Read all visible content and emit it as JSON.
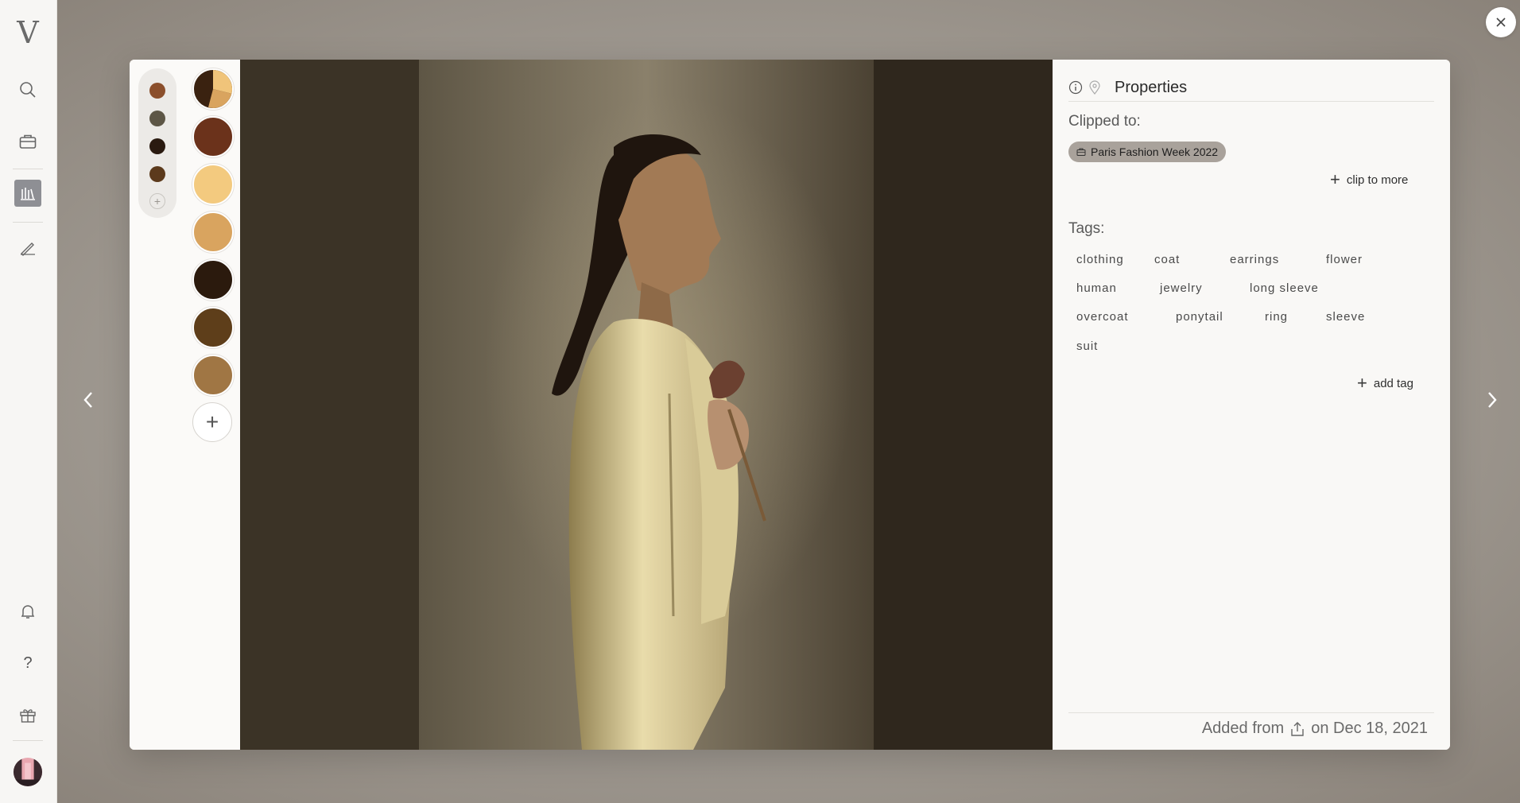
{
  "sidebar": {
    "logo": "V",
    "items": [
      {
        "icon": "search-icon"
      },
      {
        "icon": "briefcase-icon"
      },
      {
        "icon": "library-icon",
        "active": true
      },
      {
        "icon": "pen-icon"
      },
      {
        "icon": "bell-icon"
      },
      {
        "icon": "help-icon",
        "glyph": "?"
      },
      {
        "icon": "gift-icon"
      },
      {
        "icon": "avatar"
      }
    ]
  },
  "palette": {
    "small_colors": [
      "#8b4f2c",
      "#5d5646",
      "#2a1a10",
      "#5c3a1c"
    ],
    "large_colors": [
      "#6b321b",
      "#f3ca7f",
      "#d9a45f",
      "#2b1a0d",
      "#5e3e1a",
      "#a07644"
    ],
    "mix_colors": [
      "#3a2210",
      "#d9a45f",
      "#f0c47a"
    ],
    "small_add": "+",
    "large_add": "+"
  },
  "properties": {
    "title": "Properties",
    "clipped_label": "Clipped to:",
    "board_chip": "Paris Fashion Week 2022",
    "clip_more": "clip to more",
    "tags_label": "Tags:",
    "tags": [
      "clothing",
      "coat",
      "earrings",
      "flower",
      "human",
      "jewelry",
      "long sleeve",
      "overcoat",
      "ponytail",
      "ring",
      "sleeve",
      "suit"
    ],
    "add_tag": "add tag",
    "footer_prefix": "Added from",
    "footer_suffix": "on Dec 18, 2021"
  },
  "icons": {
    "info": "info-icon",
    "location": "pin-icon",
    "close": "close-icon",
    "prev": "chevron-left-icon",
    "next": "chevron-right-icon",
    "upload": "upload-icon"
  }
}
